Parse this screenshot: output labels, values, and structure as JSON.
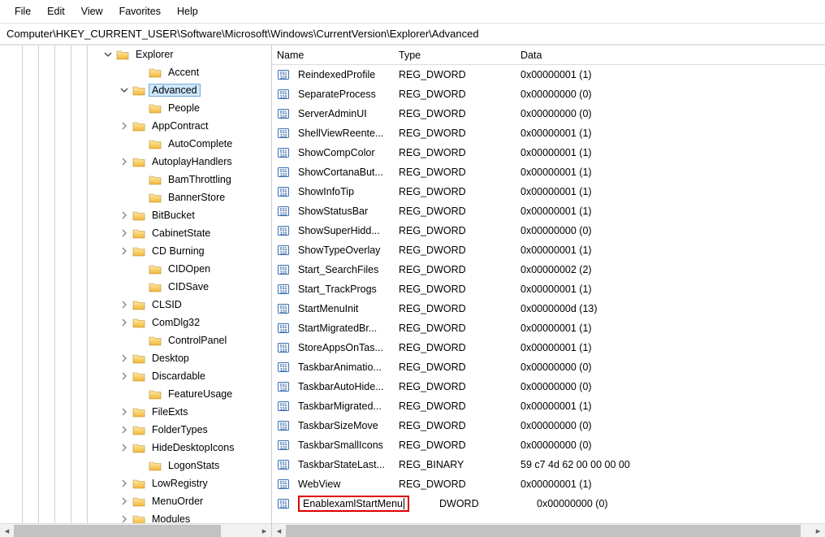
{
  "menu": {
    "file": "File",
    "edit": "Edit",
    "view": "View",
    "favorites": "Favorites",
    "help": "Help"
  },
  "address": "Computer\\HKEY_CURRENT_USER\\Software\\Microsoft\\Windows\\CurrentVersion\\Explorer\\Advanced",
  "tree": [
    {
      "indent": 125,
      "exp": "open",
      "label": "Explorer"
    },
    {
      "indent": 165,
      "exp": "none",
      "label": "Accent"
    },
    {
      "indent": 145,
      "exp": "open",
      "label": "Advanced",
      "selected": true
    },
    {
      "indent": 165,
      "exp": "none",
      "label": "People"
    },
    {
      "indent": 145,
      "exp": "closed",
      "label": "AppContract"
    },
    {
      "indent": 165,
      "exp": "none",
      "label": "AutoComplete"
    },
    {
      "indent": 145,
      "exp": "closed",
      "label": "AutoplayHandlers"
    },
    {
      "indent": 165,
      "exp": "none",
      "label": "BamThrottling"
    },
    {
      "indent": 165,
      "exp": "none",
      "label": "BannerStore"
    },
    {
      "indent": 145,
      "exp": "closed",
      "label": "BitBucket"
    },
    {
      "indent": 145,
      "exp": "closed",
      "label": "CabinetState"
    },
    {
      "indent": 145,
      "exp": "closed",
      "label": "CD Burning"
    },
    {
      "indent": 165,
      "exp": "none",
      "label": "CIDOpen"
    },
    {
      "indent": 165,
      "exp": "none",
      "label": "CIDSave"
    },
    {
      "indent": 145,
      "exp": "closed",
      "label": "CLSID"
    },
    {
      "indent": 145,
      "exp": "closed",
      "label": "ComDlg32"
    },
    {
      "indent": 165,
      "exp": "none",
      "label": "ControlPanel"
    },
    {
      "indent": 145,
      "exp": "closed",
      "label": "Desktop"
    },
    {
      "indent": 145,
      "exp": "closed",
      "label": "Discardable"
    },
    {
      "indent": 165,
      "exp": "none",
      "label": "FeatureUsage"
    },
    {
      "indent": 145,
      "exp": "closed",
      "label": "FileExts"
    },
    {
      "indent": 145,
      "exp": "closed",
      "label": "FolderTypes"
    },
    {
      "indent": 145,
      "exp": "closed",
      "label": "HideDesktopIcons"
    },
    {
      "indent": 165,
      "exp": "none",
      "label": "LogonStats"
    },
    {
      "indent": 145,
      "exp": "closed",
      "label": "LowRegistry"
    },
    {
      "indent": 145,
      "exp": "closed",
      "label": "MenuOrder"
    },
    {
      "indent": 145,
      "exp": "closed",
      "label": "Modules"
    }
  ],
  "headers": {
    "name": "Name",
    "type": "Type",
    "data": "Data"
  },
  "values": [
    {
      "name": "ReindexedProfile",
      "type": "REG_DWORD",
      "data": "0x00000001 (1)"
    },
    {
      "name": "SeparateProcess",
      "type": "REG_DWORD",
      "data": "0x00000000 (0)"
    },
    {
      "name": "ServerAdminUI",
      "type": "REG_DWORD",
      "data": "0x00000000 (0)"
    },
    {
      "name": "ShellViewReente...",
      "type": "REG_DWORD",
      "data": "0x00000001 (1)"
    },
    {
      "name": "ShowCompColor",
      "type": "REG_DWORD",
      "data": "0x00000001 (1)"
    },
    {
      "name": "ShowCortanaBut...",
      "type": "REG_DWORD",
      "data": "0x00000001 (1)"
    },
    {
      "name": "ShowInfoTip",
      "type": "REG_DWORD",
      "data": "0x00000001 (1)"
    },
    {
      "name": "ShowStatusBar",
      "type": "REG_DWORD",
      "data": "0x00000001 (1)"
    },
    {
      "name": "ShowSuperHidd...",
      "type": "REG_DWORD",
      "data": "0x00000000 (0)"
    },
    {
      "name": "ShowTypeOverlay",
      "type": "REG_DWORD",
      "data": "0x00000001 (1)"
    },
    {
      "name": "Start_SearchFiles",
      "type": "REG_DWORD",
      "data": "0x00000002 (2)"
    },
    {
      "name": "Start_TrackProgs",
      "type": "REG_DWORD",
      "data": "0x00000001 (1)"
    },
    {
      "name": "StartMenuInit",
      "type": "REG_DWORD",
      "data": "0x0000000d (13)"
    },
    {
      "name": "StartMigratedBr...",
      "type": "REG_DWORD",
      "data": "0x00000001 (1)"
    },
    {
      "name": "StoreAppsOnTas...",
      "type": "REG_DWORD",
      "data": "0x00000001 (1)"
    },
    {
      "name": "TaskbarAnimatio...",
      "type": "REG_DWORD",
      "data": "0x00000000 (0)"
    },
    {
      "name": "TaskbarAutoHide...",
      "type": "REG_DWORD",
      "data": "0x00000000 (0)"
    },
    {
      "name": "TaskbarMigrated...",
      "type": "REG_DWORD",
      "data": "0x00000001 (1)"
    },
    {
      "name": "TaskbarSizeMove",
      "type": "REG_DWORD",
      "data": "0x00000000 (0)"
    },
    {
      "name": "TaskbarSmallIcons",
      "type": "REG_DWORD",
      "data": "0x00000000 (0)"
    },
    {
      "name": "TaskbarStateLast...",
      "type": "REG_BINARY",
      "data": "59 c7 4d 62 00 00 00 00"
    },
    {
      "name": "WebView",
      "type": "REG_DWORD",
      "data": "0x00000001 (1)"
    },
    {
      "name": "EnablexamlStartMenu",
      "type": "DWORD",
      "data": "0x00000000 (0)",
      "editing": true
    }
  ]
}
